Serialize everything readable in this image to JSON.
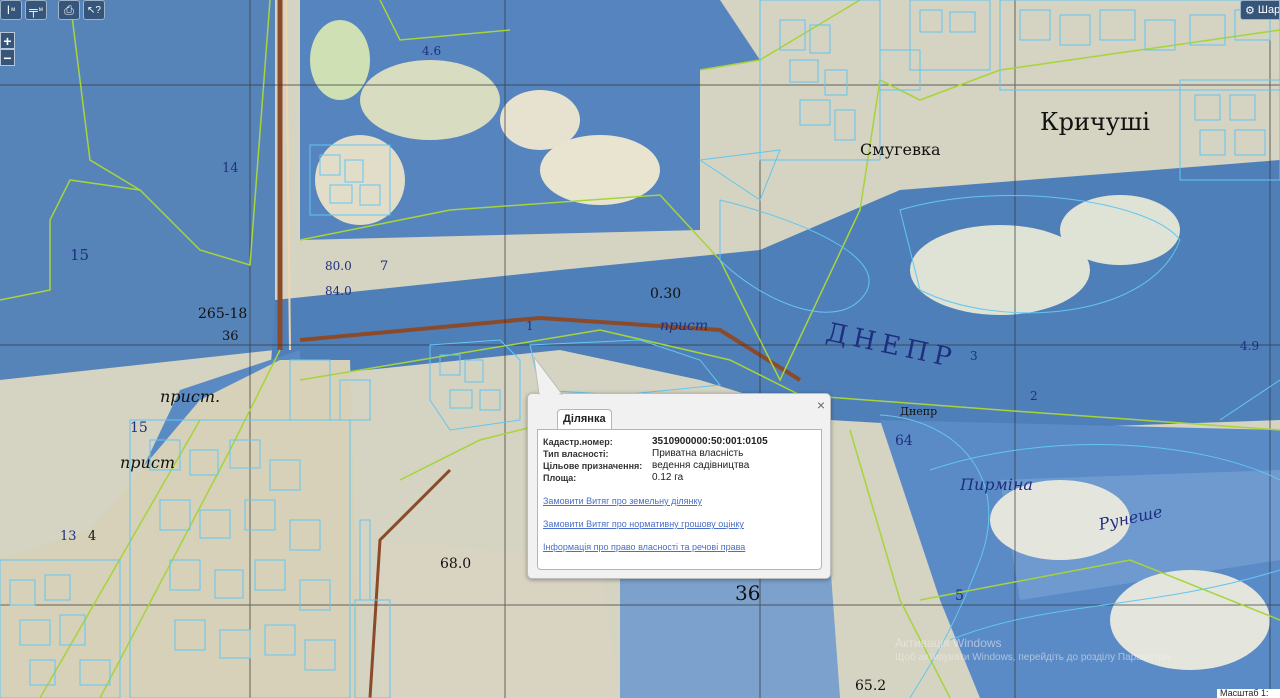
{
  "toolbar": {
    "buttons": [
      {
        "name": "measure-length",
        "glyph": "I",
        "sub": "м"
      },
      {
        "name": "measure-area",
        "glyph": "╤",
        "sub": "м"
      },
      {
        "name": "print",
        "glyph": "⎙"
      },
      {
        "name": "identify",
        "glyph": "↖?"
      }
    ],
    "layers_label": "Шар",
    "layers_icon": "gear-icon"
  },
  "zoom": {
    "in": "+",
    "out": "−"
  },
  "map": {
    "labels": [
      "4.6",
      "14",
      "15",
      "7",
      "80.0",
      "84.0",
      "265-18",
      "36",
      "прист.",
      "15",
      "прист",
      "13",
      "4",
      "Смугевка",
      "Кричуші",
      "ДНЕПР",
      "0.30",
      "прист",
      "68.0",
      "36",
      "65.2",
      "Пирміна",
      "Рунеше",
      "64",
      "5",
      "4.9",
      "1",
      "3",
      "2",
      "Днепр"
    ],
    "colors": {
      "water": "#4f7fb8",
      "land": "#d9d6c6",
      "boundary": "#a8d63a",
      "parcel": "#5ec3f0"
    }
  },
  "popup": {
    "tab": "Ділянка",
    "close": "×",
    "fields": [
      {
        "label": "Кадастр.номер:",
        "value": "3510900000:50:001:0105"
      },
      {
        "label": "Тип власності:",
        "value": "Приватна власність"
      },
      {
        "label": "Цільове призначення:",
        "value": "ведення садівництва"
      },
      {
        "label": "Площа:",
        "value": "0.12 га"
      }
    ],
    "links": [
      "Замовити Витяг про земельну ділянку",
      "Замовити Витяг про нормативну грошову оцінку",
      "Інформація про право власності та речові права"
    ]
  },
  "watermark": {
    "title": "Активація Windows",
    "subtitle": "Щоб активувати Windows, перейдіть до розділу Параметри."
  },
  "scale": {
    "label": "Масштаб 1:"
  }
}
